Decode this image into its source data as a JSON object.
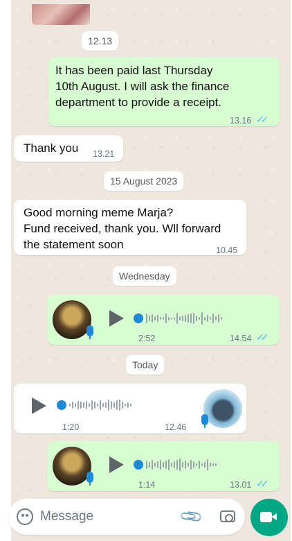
{
  "messages": {
    "pill_1213": "12.13",
    "m1_text": "It has been paid last Thursday\n10th August. I will ask the finance\ndepartment to provide a receipt.",
    "m1_time": "13.16",
    "m2_text": "Thank you",
    "m2_time": "13.21",
    "date_1": "15 August 2023",
    "m3_text": "Good morning meme Marja?\nFund received, thank you. Wll forward\nthe statement soon",
    "m3_time": "10.45",
    "date_2": "Wednesday",
    "v1_duration": "2:52",
    "v1_time": "14.54",
    "date_3": "Today",
    "v2_duration": "1:20",
    "v2_time": "12.46",
    "v3_duration": "1:14",
    "v3_time": "13.01",
    "ticks": "✓✓"
  },
  "input": {
    "placeholder": "Message"
  },
  "colors": {
    "outgoing": "#d9fdd3",
    "incoming": "#ffffff",
    "read_ticks": "#53bdeb",
    "accent": "#00a884"
  },
  "icons": [
    "emoji-icon",
    "attach-icon",
    "camera-icon",
    "video-icon",
    "mic-icon",
    "play-icon"
  ]
}
